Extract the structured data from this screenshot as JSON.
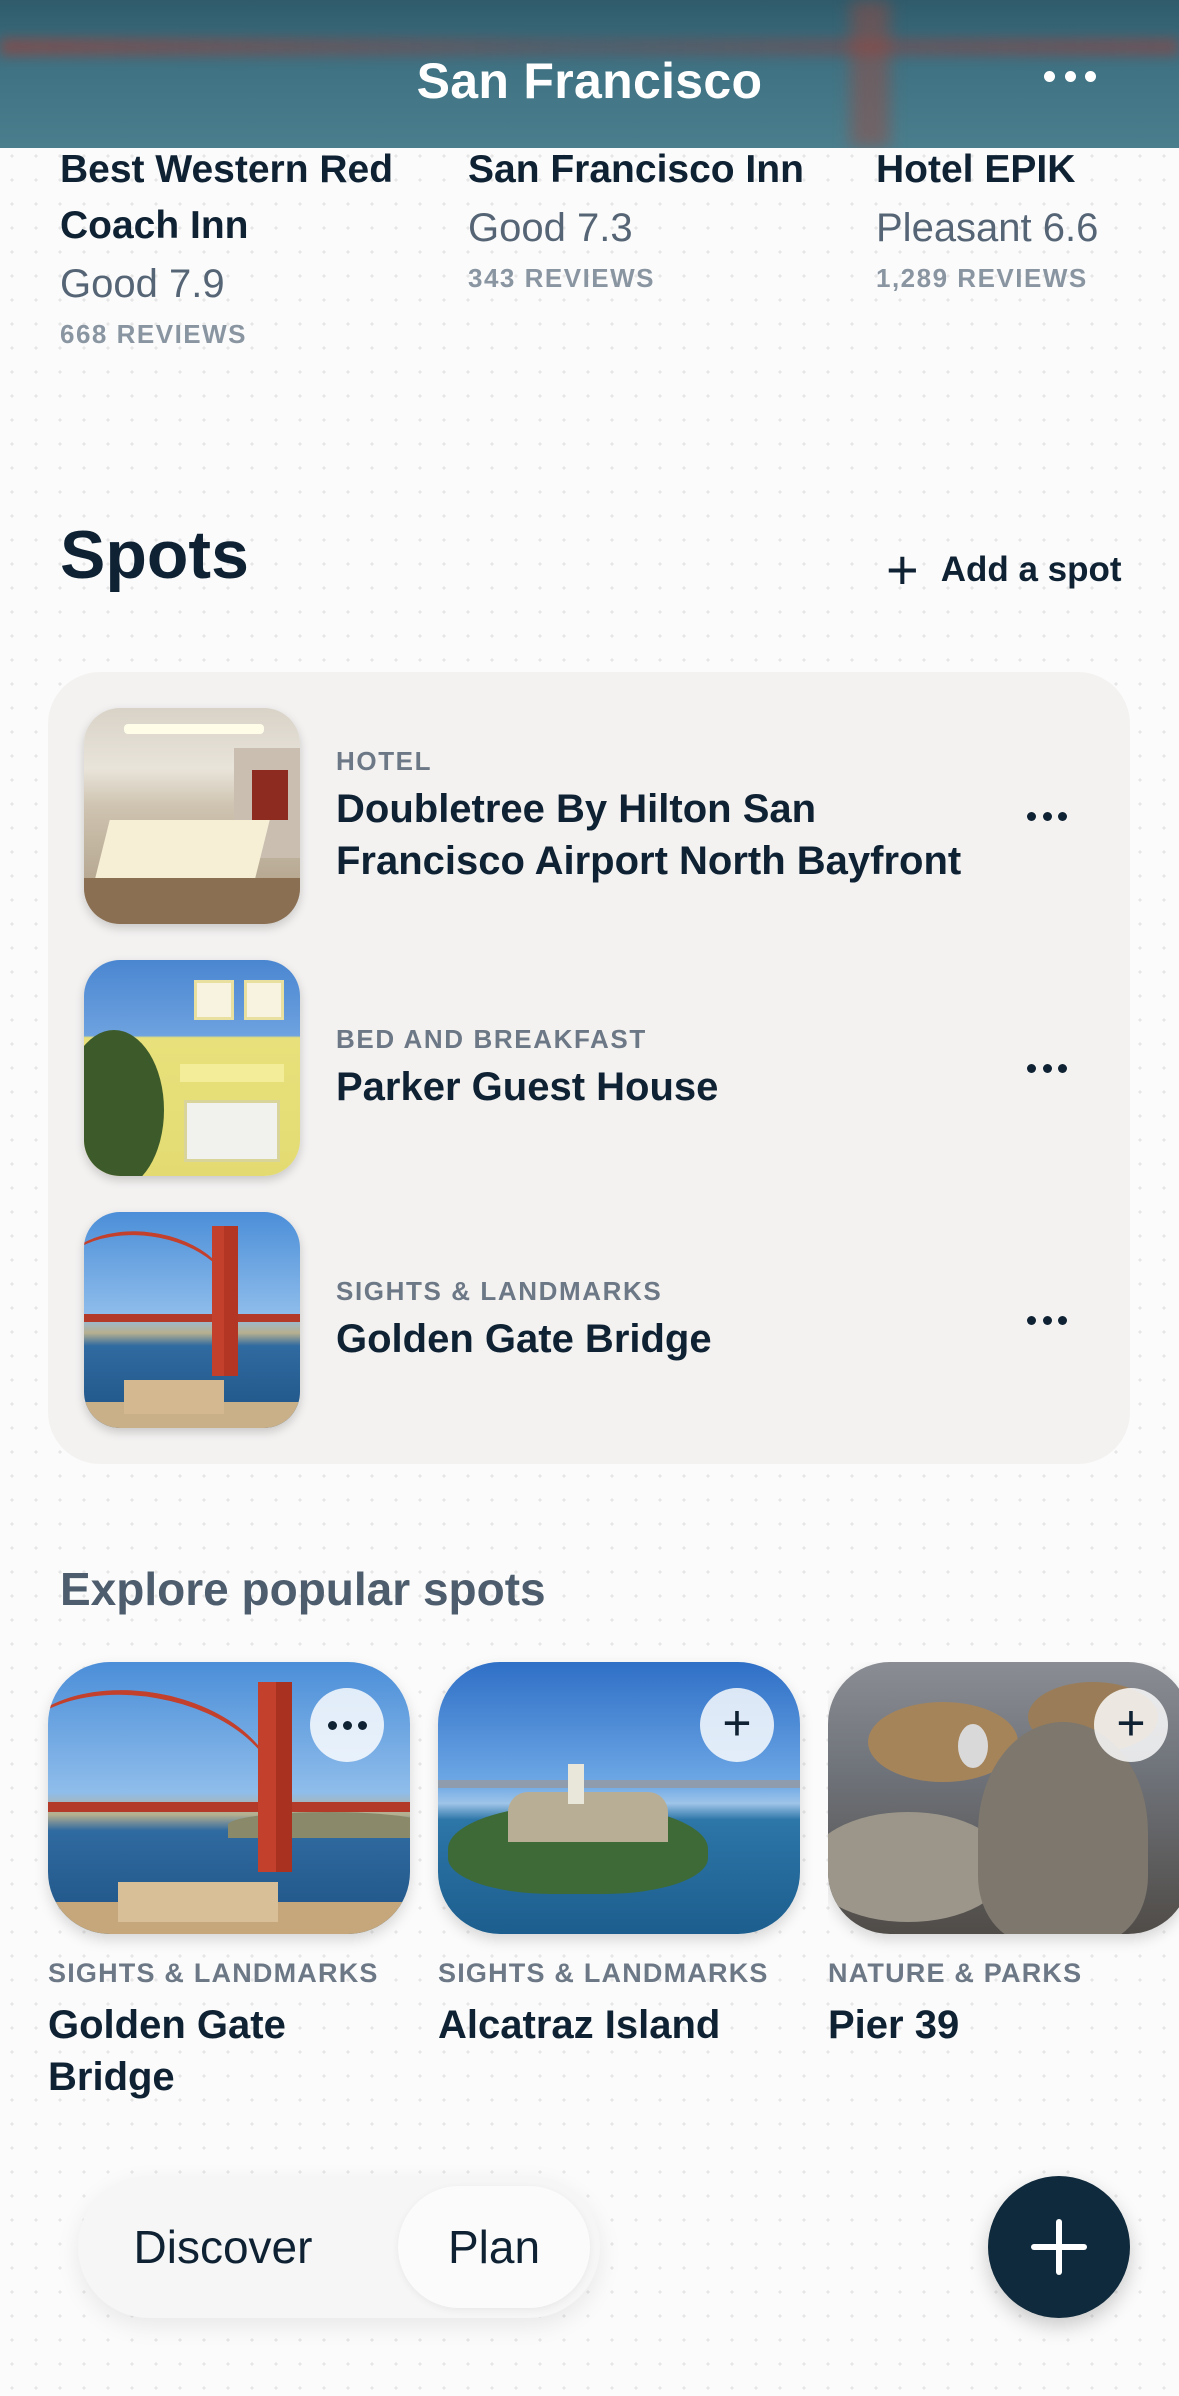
{
  "header": {
    "title": "San Francisco",
    "more_icon": "more-horizontal-icon"
  },
  "hotels": [
    {
      "name": "Best Western Red Coach Inn",
      "rating": "Good 7.9",
      "reviews": "668 REVIEWS"
    },
    {
      "name": "San Francisco Inn",
      "rating": "Good 7.3",
      "reviews": "343 REVIEWS"
    },
    {
      "name": "Hotel EPIK",
      "rating": "Pleasant 6.6",
      "reviews": "1,289 REVIEWS"
    }
  ],
  "spots": {
    "title": "Spots",
    "add_label": "Add a spot",
    "add_icon": "plus-icon",
    "items": [
      {
        "category": "HOTEL",
        "name": "Doubletree By Hilton San Francisco Airport North Bayfront"
      },
      {
        "category": "BED AND BREAKFAST",
        "name": "Parker Guest House"
      },
      {
        "category": "SIGHTS & LANDMARKS",
        "name": "Golden Gate Bridge"
      }
    ]
  },
  "explore": {
    "title": "Explore popular spots",
    "cards": [
      {
        "category": "SIGHTS & LANDMARKS",
        "name": "Golden Gate Bridge",
        "action_icon": "more-horizontal-icon"
      },
      {
        "category": "SIGHTS & LANDMARKS",
        "name": "Alcatraz Island",
        "action_icon": "plus-icon"
      },
      {
        "category": "NATURE & PARKS",
        "name": "Pier 39",
        "action_icon": "plus-icon"
      }
    ]
  },
  "bottom_nav": {
    "discover": "Discover",
    "plan": "Plan",
    "selected": "Plan",
    "fab_icon": "plus-icon"
  },
  "colors": {
    "primary": "#0f2233",
    "fab": "#0f2a3c",
    "muted": "#6d7886",
    "card_bg": "#f3f2f1"
  }
}
